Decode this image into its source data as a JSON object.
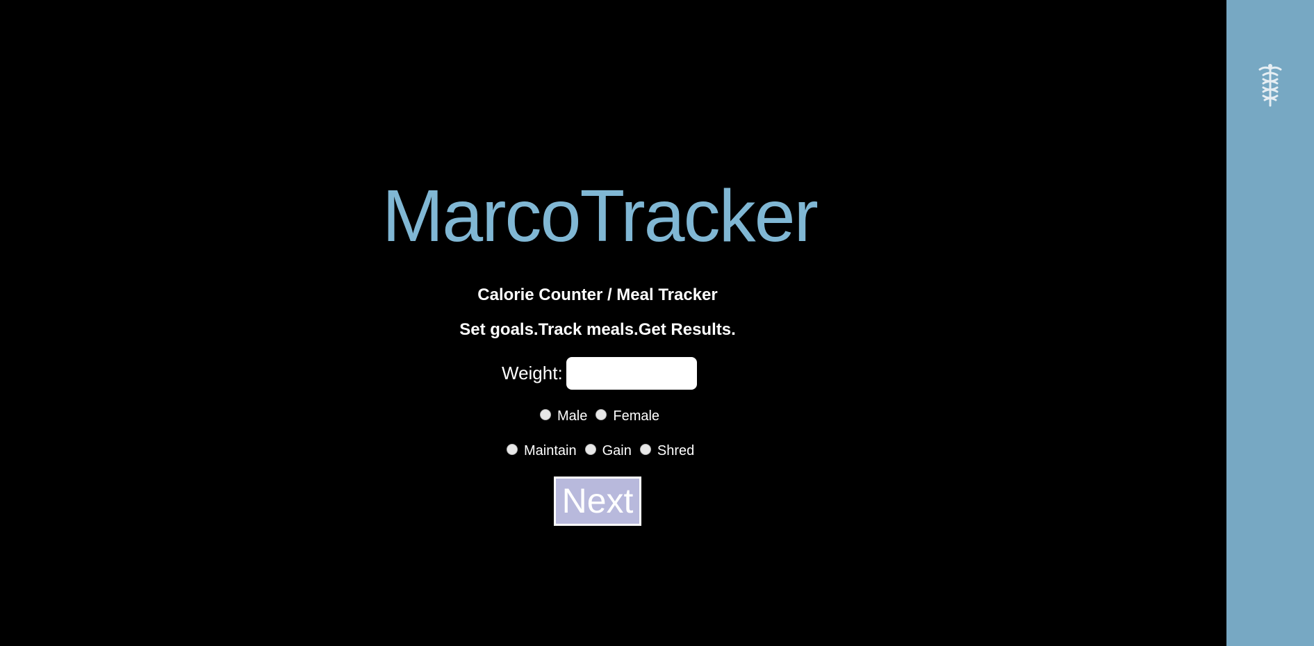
{
  "app": {
    "title": "MarcoTracker",
    "subtitle": "Calorie Counter / Meal Tracker",
    "tagline": "Set goals.Track meals.Get Results."
  },
  "form": {
    "weight_label": "Weight:",
    "weight_value": "",
    "weight_placeholder": "",
    "gender_options": [
      "Male",
      "Female"
    ],
    "goal_options": [
      "Maintain",
      "Gain",
      "Shred"
    ],
    "next_label": "Next"
  },
  "sidebar": {
    "icon": "caduceus-icon"
  },
  "colors": {
    "background": "#000000",
    "sidebar": "#77a8c3",
    "title": "#80b7d4",
    "button": "#b8b9dc",
    "text": "#ffffff"
  }
}
